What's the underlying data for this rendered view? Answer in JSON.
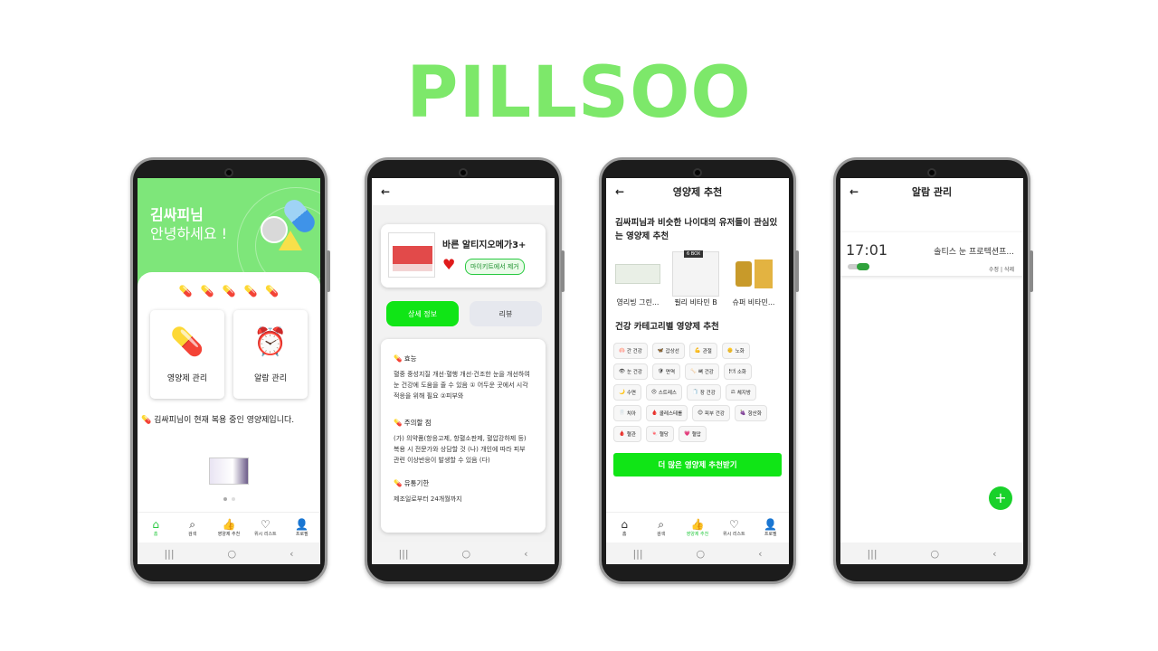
{
  "brand": {
    "title": "PILLSOO",
    "color": "#7de86a"
  },
  "colors": {
    "accent": "#10e516",
    "header_green": "#7ee67a",
    "heart": "#e01b1b"
  },
  "sysnav": {
    "recent": "|||",
    "home": "○",
    "back": "‹"
  },
  "bottom_nav": {
    "items": [
      {
        "label": "홈",
        "icon": "home-icon",
        "glyph": "⌂"
      },
      {
        "label": "검색",
        "icon": "search-icon",
        "glyph": "⌕"
      },
      {
        "label": "영양제 추천",
        "icon": "thumbs-up-icon",
        "glyph": "👍"
      },
      {
        "label": "위시 리스트",
        "icon": "heart-icon",
        "glyph": "♡"
      },
      {
        "label": "프로필",
        "icon": "person-icon",
        "glyph": "👤"
      }
    ],
    "home_active_label": "홈"
  },
  "phone1": {
    "greeting_name": "김싸피님",
    "greeting_msg": "안녕하세요 !",
    "pill_icons": [
      "💊",
      "💊",
      "💊",
      "💊",
      "💊"
    ],
    "tiles": [
      {
        "label": "영양제 관리",
        "icon": "pill-hand-icon",
        "glyph": "💊"
      },
      {
        "label": "알람 관리",
        "icon": "alarm-clock-icon",
        "glyph": "⏰"
      }
    ],
    "current_msg": "💊 김싸피님이 현재 복용 중인 영양제입니다."
  },
  "phone2": {
    "back": "←",
    "product_name": "바른 알티지오메가3+",
    "remove_label": "마이키트에서 제거",
    "tabs": {
      "detail": "상세 정보",
      "review": "리뷰"
    },
    "sections": [
      {
        "title": "💊 효능",
        "text": "혈중 중성지질 개선·혈행 개선·건조한 눈을 개선하여 눈 건강에 도움을 줄 수 있음 ① 어두운 곳에서 시각 적응을 위해 필요 ②피부와"
      },
      {
        "title": "💊 주의할 점",
        "text": "(가) 의약품(항응고제, 항혈소판제, 혈압강하제 등) 복용 시 전문가와 상담할 것 (나) 개인에 따라 피부 관련 이상반응이 발생할 수 있음 (다)"
      },
      {
        "title": "💊 유통기한",
        "text": "제조일로부터 24개월까지"
      }
    ]
  },
  "phone3": {
    "back": "←",
    "title": "영양제 추천",
    "section1": "김싸피님과 비슷한 나이대의 유저들이 관심있는 영양제 추천",
    "recos": [
      "영리빙 그린...",
      "필리 비타민 B",
      "슈퍼 비타민..."
    ],
    "reco_badge": "6 BOX",
    "section2": "건강 카테고리별 영양제 추천",
    "categories": [
      {
        "label": "간 건강",
        "glyph": "🫁"
      },
      {
        "label": "갑상선",
        "glyph": "🦋"
      },
      {
        "label": "관절",
        "glyph": "💪"
      },
      {
        "label": "노화",
        "glyph": "👴"
      },
      {
        "label": "눈 건강",
        "glyph": "👁"
      },
      {
        "label": "면역",
        "glyph": "🛡"
      },
      {
        "label": "뼈 건강",
        "glyph": "🦴"
      },
      {
        "label": "소화",
        "glyph": "🍽"
      },
      {
        "label": "수면",
        "glyph": "🌙"
      },
      {
        "label": "스트레스",
        "glyph": "😣"
      },
      {
        "label": "장 건강",
        "glyph": "🧻"
      },
      {
        "label": "체지방",
        "glyph": "⚖"
      },
      {
        "label": "치아",
        "glyph": "🦷"
      },
      {
        "label": "콜레스테롤",
        "glyph": "🩸"
      },
      {
        "label": "피부 건강",
        "glyph": "😊"
      },
      {
        "label": "항산화",
        "glyph": "🍇"
      },
      {
        "label": "혈관",
        "glyph": "🩸"
      },
      {
        "label": "혈당",
        "glyph": "🍬"
      },
      {
        "label": "혈압",
        "glyph": "💗"
      }
    ],
    "cta": "더 많은 영양제 추천받기",
    "active_nav": "영양제 추천"
  },
  "phone4": {
    "back": "←",
    "title": "알람 관리",
    "alarm_time": "17:01",
    "alarm_name": "솔티스 눈 프로텍션프...",
    "edit": "수정",
    "divider": "|",
    "delete": "삭제",
    "fab": "+"
  }
}
